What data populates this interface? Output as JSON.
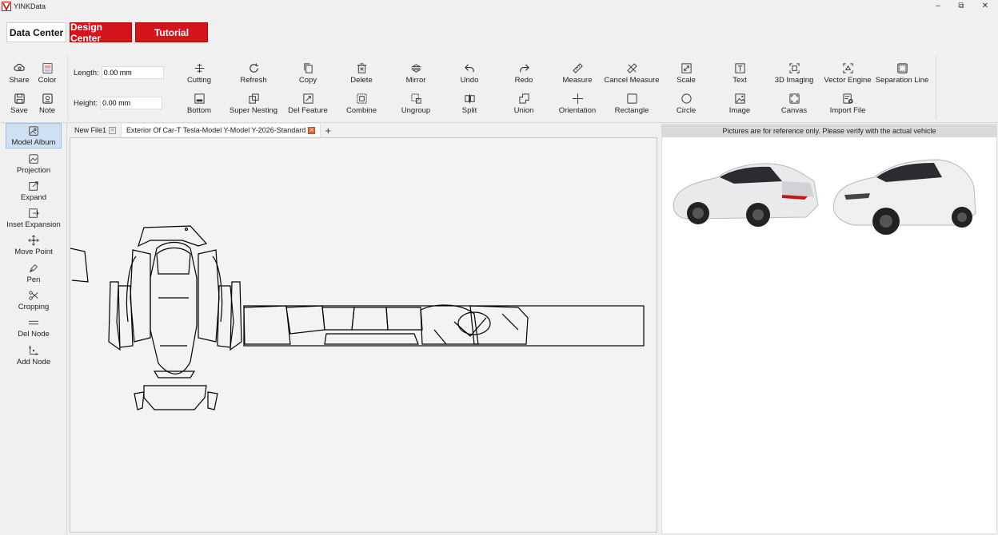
{
  "window": {
    "title": "YINKData",
    "controls": {
      "minimize": "–",
      "maximize": "⧉",
      "close": "✕"
    }
  },
  "top_tabs": [
    {
      "label": "Data Center"
    },
    {
      "label": "Design Center"
    },
    {
      "label": "Tutorial"
    }
  ],
  "toolbar": {
    "share": "Share",
    "color": "Color",
    "save": "Save",
    "note": "Note",
    "length_label": "Length:",
    "length_value": "0.00 mm",
    "height_label": "Height:",
    "height_value": "0.00 mm",
    "row1": [
      "Cutting",
      "Refresh",
      "Copy",
      "Delete",
      "Mirror",
      "Undo",
      "Redo",
      "Measure",
      "Cancel Measure",
      "Scale",
      "Text",
      "3D Imaging",
      "Vector Engine",
      "Separation Line"
    ],
    "row2": [
      "Bottom",
      "Super Nesting",
      "Del Feature",
      "Combine",
      "Ungroup",
      "Split",
      "Union",
      "Orientation",
      "Rectangle",
      "Circle",
      "Image",
      "Canvas",
      "Import File"
    ]
  },
  "sidebar": [
    {
      "label": "Model Album",
      "icon": "album-icon"
    },
    {
      "label": "Projection",
      "icon": "projection-icon"
    },
    {
      "label": "Expand",
      "icon": "expand-icon"
    },
    {
      "label": "Inset Expansion",
      "icon": "inset-expansion-icon"
    },
    {
      "label": "Move Point",
      "icon": "move-point-icon"
    },
    {
      "label": "Pen",
      "icon": "pen-icon"
    },
    {
      "label": "Cropping",
      "icon": "scissors-icon"
    },
    {
      "label": "Del Node",
      "icon": "del-node-icon"
    },
    {
      "label": "Add Node",
      "icon": "add-node-icon"
    }
  ],
  "doc_tabs": [
    {
      "label": "New File1"
    },
    {
      "label": "Exterior Of Car-T Tesla-Model Y-Model Y-2026-Standard"
    }
  ],
  "add_tab": "+",
  "reference": {
    "notice": "Pictures are for reference only. Please verify with the actual vehicle"
  },
  "colors": {
    "accent": "#d4141c",
    "selected": "#cfe0f5"
  }
}
